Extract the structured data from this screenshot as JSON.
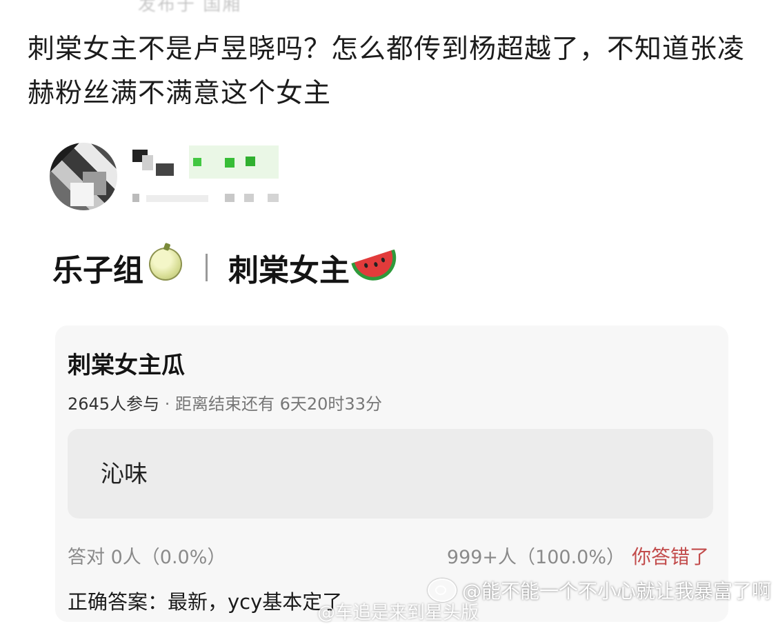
{
  "post": {
    "top_cut_text": "发布于 国厢",
    "text": "刺棠女主不是卢昱晓吗？怎么都传到杨超越了，不知道张凌赫粉丝满不满意这个女主"
  },
  "author": {
    "name": "",
    "meta": ""
  },
  "group_header": {
    "group_name": "乐子组",
    "topic": "刺棠女主"
  },
  "poll": {
    "title": "刺棠女主瓜",
    "participants": "2645人参与",
    "separator": "·",
    "countdown": "距离结束还有 6天20时33分",
    "option_text": "沁味",
    "correct_stat": "答对  0人（0.0%）",
    "wrong_stat": "999+人（100.0%）",
    "result_label": "你答错了",
    "answer": "正确答案：最新，ycy基本定了"
  },
  "watermark": {
    "line1": "@能不能一个不小心就让我暴富了啊",
    "line2": "@车追是来到星头版"
  },
  "colors": {
    "wrong_red": "#c24b4b",
    "card_bg": "#f7f7f7",
    "option_bg": "#ececec"
  },
  "icons": [
    "melon-emoji-icon",
    "watermelon-emoji-icon",
    "weibo-logo-icon"
  ]
}
